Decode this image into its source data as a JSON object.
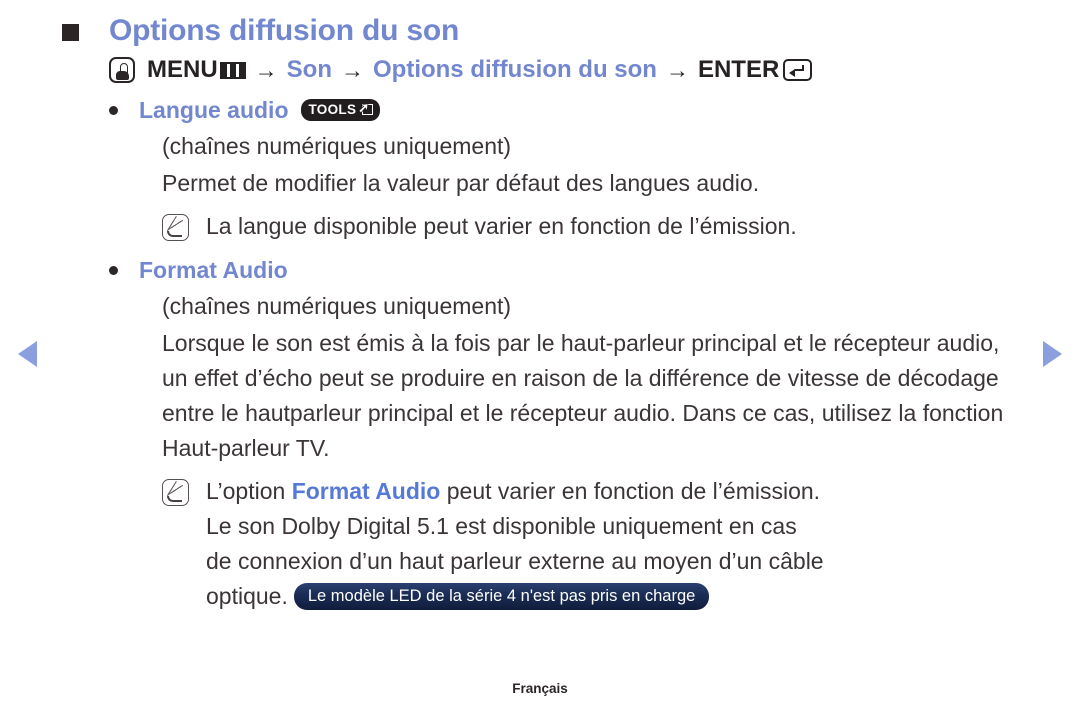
{
  "nav": {
    "prev_icon": "triangle-left-icon",
    "next_icon": "triangle-right-icon",
    "arrow_color": "#8b9ede"
  },
  "heading": {
    "bullet_icon": "square-bullet-icon",
    "title": "Options diffusion du son",
    "color": "#7287cf"
  },
  "menu_path": {
    "hand_icon": "hand-press-icon",
    "menu_label": "MENU",
    "menu_glyph_icon": "menu-grid-icon",
    "arrow1": "→",
    "item1": "Son",
    "arrow2": "→",
    "item2": "Options diffusion du son",
    "arrow3": "→",
    "enter_label": "ENTER",
    "enter_glyph_icon": "enter-key-icon"
  },
  "sections": [
    {
      "bullet_icon": "dot-bullet-icon",
      "label": "Langue audio",
      "badge": {
        "text": "TOOLS",
        "glyph_icon": "tools-arrow-icon",
        "background": "#221e1f",
        "color": "#ffffff"
      },
      "lines": [
        "(chaînes numériques uniquement)",
        "Permet de modifier la valeur par défaut des langues audio."
      ],
      "note": {
        "icon": "note-pencil-icon",
        "text": "La langue disponible peut varier en fonction de l’émission."
      }
    },
    {
      "bullet_icon": "dot-bullet-icon",
      "label": "Format Audio",
      "lines": [
        "(chaînes numériques uniquement)",
        "Lorsque le son est émis à la fois par le haut-parleur principal et le récepteur audio, un effet d’écho peut se produire en raison de la différence de vitesse de décodage entre le hautparleur principal et le récepteur audio. Dans ce cas, utilisez la fonction Haut-parleur TV."
      ],
      "note": {
        "icon": "note-pencil-icon",
        "text_before": "L’option ",
        "emphasis": "Format Audio",
        "text_after": " peut varier en fonction de l’émission.",
        "line2": "Le son Dolby Digital 5.1 est disponible uniquement en cas",
        "line3": "de connexion d’un haut parleur externe au moyen d’un câble",
        "line4": "optique.",
        "pill": {
          "text": "Le modèle LED de la série 4 n'est pas pris en charge",
          "background": "#1b2d55",
          "color": "#ffffff"
        }
      }
    }
  ],
  "footer": {
    "language": "Français"
  }
}
